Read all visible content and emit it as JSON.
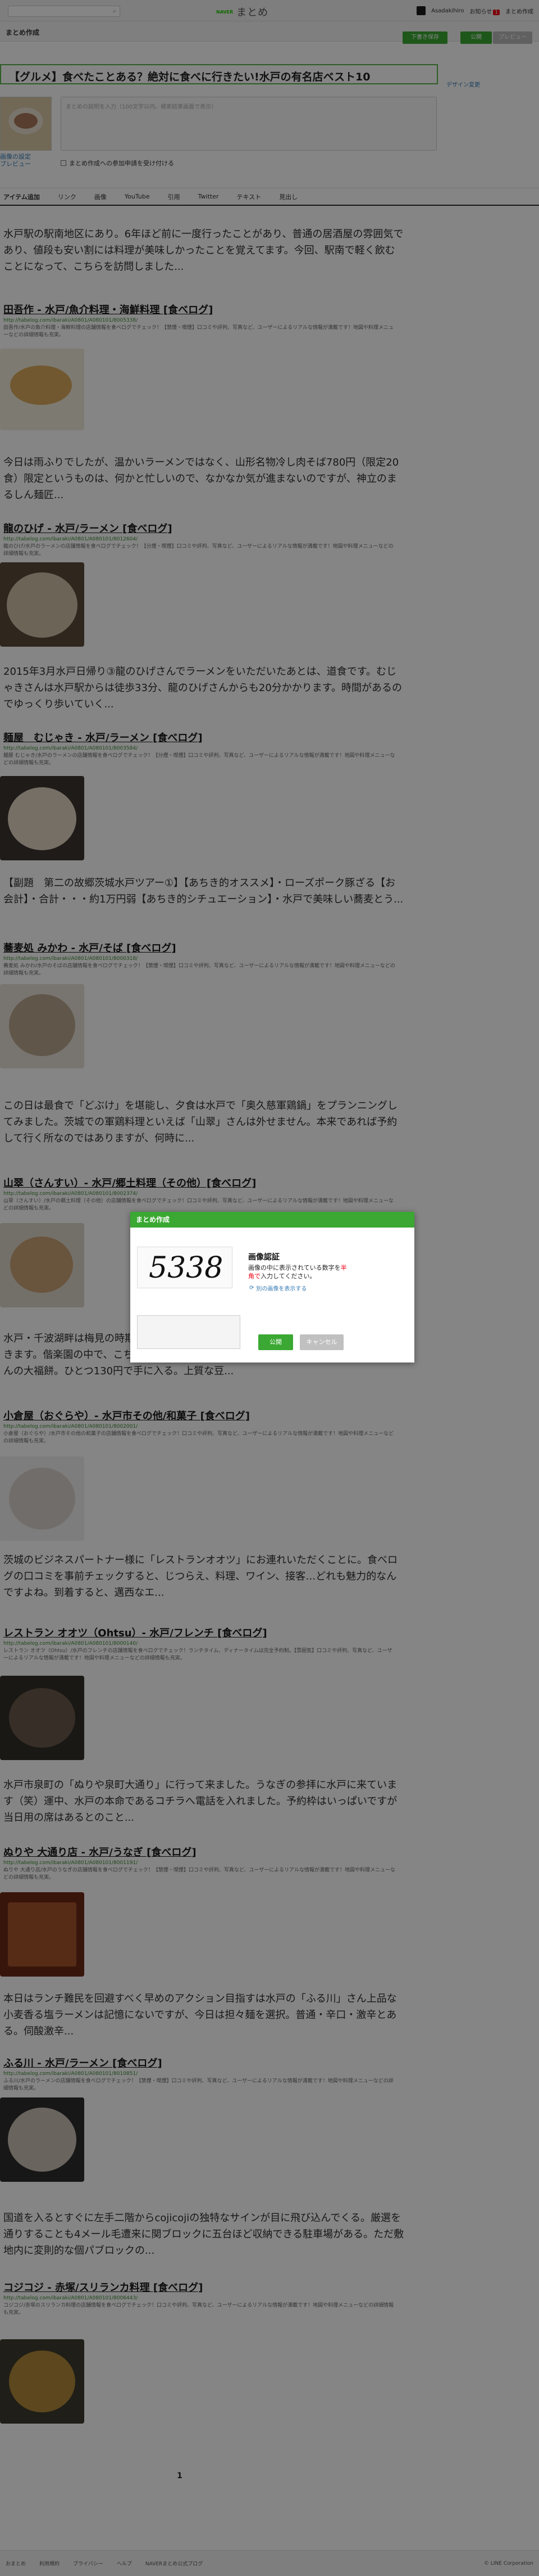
{
  "header": {
    "brand_small": "NAVER",
    "brand_main": "まとめ",
    "user_name": "Asadakihiro",
    "notifications_label": "お知らせ",
    "notifications_count": "1",
    "my_matome_label": "まとめ作成"
  },
  "subbar": {
    "section_title": "まとめ作成",
    "draft_button": "下書き保存",
    "publish_button": "公開",
    "preview_button": "プレビュー"
  },
  "editor": {
    "title": "【グルメ】食べたことある？絶対に食べに行きたい!水戸の有名店ベスト10",
    "design_link": "デザイン変更",
    "thumb_caption_line1": "画像の設定",
    "thumb_caption_line2": "プレビュー",
    "description_placeholder": "まとめの説明を入力（100文字以内。検索結果画面で表示）",
    "co_edit_label": "まとめ作成への参加申請を受け付ける"
  },
  "tabs": [
    "アイテム追加",
    "リンク",
    "画像",
    "YouTube",
    "引用",
    "Twitter",
    "テキスト",
    "見出し"
  ],
  "items": [
    {
      "quote": "水戸駅の駅南地区にあり。6年ほど前に一度行ったことがあり、普通の居酒屋の雰囲気であり、値段も安い割には料理が美味しかったことを覚えてます。今回、駅南で軽く飲むことになって、こちらを訪問しました...",
      "link": "田吾作 - 水戸/魚介料理・海鮮料理 [食べログ]",
      "url": "http://tabelog.com/ibaraki/A0801/A080101/8005338/",
      "desc": "田吾作/水戸の魚介料理・海鮮料理の店舗情報を食べログでチェック！【禁煙・喫煙】口コミや評判、写真など、ユーザーによるリアルな情報が満載です！地図や料理メニューなどの詳細情報も充実。"
    },
    {
      "quote": "今日は雨ふりでしたが、温かいラーメンではなく、山形名物冷し肉そば780円（限定20食）限定というものは、何かと忙しいので、なかなか気が進まないのですが、神立のまるしん麺匠...",
      "link": "龍のひげ - 水戸/ラーメン [食べログ]",
      "url": "http://tabelog.com/ibaraki/A0801/A080101/8012604/",
      "desc": "龍のひげ/水戸のラーメンの店舗情報を食べログでチェック！【分煙・喫煙】口コミや評判、写真など、ユーザーによるリアルな情報が満載です！地図や料理メニューなどの詳細情報も充実。"
    },
    {
      "quote": "2015年3月水戸日帰り③龍のひげさんでラーメンをいただいたあとは、道食です。むじゃきさんは水戸駅からは徒歩33分、龍のひげさんからも20分かかります。時間があるのでゆっくり歩いていく...",
      "link": "麺屋　むじゃき - 水戸/ラーメン [食べログ]",
      "url": "http://tabelog.com/ibaraki/A0801/A080101/8003584/",
      "desc": "麺屋 むじゃき/水戸のラーメンの店舗情報を食べログでチェック！【分煙・喫煙】口コミや評判、写真など、ユーザーによるリアルな情報が満載です！地図や料理メニューなどの詳細情報も充実。"
    },
    {
      "quote": "【副題　第二の故郷茨城水戸ツアー①】【あちき的オススメ】・ローズポーク豚ざる【お会計】・合計・・・約1万円弱【あちき的シチュエーション】・水戸で美味しい蕎麦とう...",
      "link": "蕎麦処 みかわ - 水戸/そば [食べログ]",
      "url": "http://tabelog.com/ibaraki/A0801/A080101/8000318/",
      "desc": "蕎麦処 みかわ/水戸のそばの店舗情報を食べログでチェック！【禁煙・喫煙】口コミや評判、写真など、ユーザーによるリアルな情報が満載です！地図や料理メニューなどの詳細情報も充実。"
    },
    {
      "quote": "この日は最食で「どぶけ」を堪能し、夕食は水戸で「奥久慈軍鶏鍋」をプランニングしてみました。茨城での軍鶏料理といえば「山翠」さんは外せません。本来であれば予約して行く所なのではありますが、何時に...",
      "link": "山翠（さんすい）- 水戸/郷土料理（その他）[食べログ]",
      "url": "http://tabelog.com/ibaraki/A0801/A080101/8002374/",
      "desc": "山翠（さんすい）/水戸の郷土料理（その他）の店舗情報を食べログでチェック！口コミや評判、写真など、ユーザーによるリアルな情報が満載です！地図や料理メニューなどの詳細情報も充実。"
    },
    {
      "quote": "水戸・千波湖畔は梅見の時期でにぎわっています。梅見の後、偕楽生活道路を選んで行きます。偕楽園の中で、こちらの名物である「お祭りでしか食べられない「小倉屋」さんの大福餅。ひとつ130円で手に入る。上質な豆...",
      "link": "小倉屋（おぐらや）- 水戸市その他/和菓子 [食べログ]",
      "url": "http://tabelog.com/ibaraki/A0801/A080101/8002001/",
      "desc": "小倉屋（おぐらや）/水戸市その他の和菓子の店舗情報を食べログでチェック！口コミや評判、写真など、ユーザーによるリアルな情報が満載です！地図や料理メニューなどの詳細情報も充実。"
    },
    {
      "quote": "茨城のビジネスパートナー様に「レストランオオツ」にお連れいただくことに。食べログの口コミを事前チェックすると、じつらえ、料理、ワイン、接客…どれも魅力的なんですよね。到着すると、邁西なエ...",
      "link": "レストラン オオツ（Ohtsu）- 水戸/フレンチ [食べログ]",
      "url": "http://tabelog.com/ibaraki/A0801/A080101/8000140/",
      "desc": "レストラン オオツ（Ohtsu）/水戸のフレンチの店舗情報を食べログでチェック！ランチタイム、ディナータイムは完全予約制。【雰囲気】口コミや評判、写真など、ユーザーによるリアルな情報が満載です！地図や料理メニューなどの詳細情報も充実。"
    },
    {
      "quote": "水戸市泉町の「ぬりや泉町大通り」に行って来ました。うなぎの参拝に水戸に来ています（笑）運中、水戸の本命であるコチラへ電話を入れました。予約枠はいっぱいですが当日用の席はあるとのこと...",
      "link": "ぬりや 大通り店 - 水戸/うなぎ [食べログ]",
      "url": "http://tabelog.com/ibaraki/A0801/A080101/8001191/",
      "desc": "ぬりや 大通り店/水戸のうなぎの店舗情報を食べログでチェック！【禁煙・喫煙】口コミや評判、写真など、ユーザーによるリアルな情報が満載です！地図や料理メニューなどの詳細情報も充実。"
    },
    {
      "quote": "本日はランチ難民を回避すべく早めのアクション目指すは水戸の「ふる川」さん上品な小麦香る塩ラーメンは記憶にないですが、今日は担々麺を選択。普通・辛口・激辛とある。伺酸激辛...",
      "link": "ふる川 - 水戸/ラーメン [食べログ]",
      "url": "http://tabelog.com/ibaraki/A0801/A080101/8010851/",
      "desc": "ふる川/水戸のラーメンの店舗情報を食べログでチェック！【禁煙・喫煙】口コミや評判、写真など、ユーザーによるリアルな情報が満載です！地図や料理メニューなどの詳細情報も充実。"
    },
    {
      "quote": "国道を入るとすぐに左手二階からcojicojiの独特なサインが目に飛び込んでくる。厳選を通りすることも4メール毛遭来に関ブロックに五台ほど収納できる駐車場がある。ただ敷地内に変則的な個パブロックの...",
      "link": "コジコジ - 赤塚/スリランカ料理 [食べログ]",
      "url": "http://tabelog.com/ibaraki/A0801/A080101/8006443/",
      "desc": "コジコジ/赤塚のスリランカ料理の店舗情報を食べログでチェック！口コミや評判、写真など、ユーザーによるリアルな情報が満載です！地図や料理メニューなどの詳細情報も充実。"
    }
  ],
  "pagination": {
    "current": "1"
  },
  "modal": {
    "header": "まとめ作成",
    "captcha_code": "5338",
    "heading": "画像認証",
    "text_before": "画像の中に表示されている数字を",
    "text_red": "半角で",
    "text_after": "入力してください。",
    "refresh_label": "別の画像を表示する",
    "ok_label": "公開",
    "cancel_label": "キャンセル"
  },
  "footer": {
    "links": [
      "おまとめ",
      "利用規約",
      "プライバシー",
      "ヘルプ",
      "NAVERまとめ公式ブログ"
    ],
    "copyright": "© LINE Corporation"
  }
}
